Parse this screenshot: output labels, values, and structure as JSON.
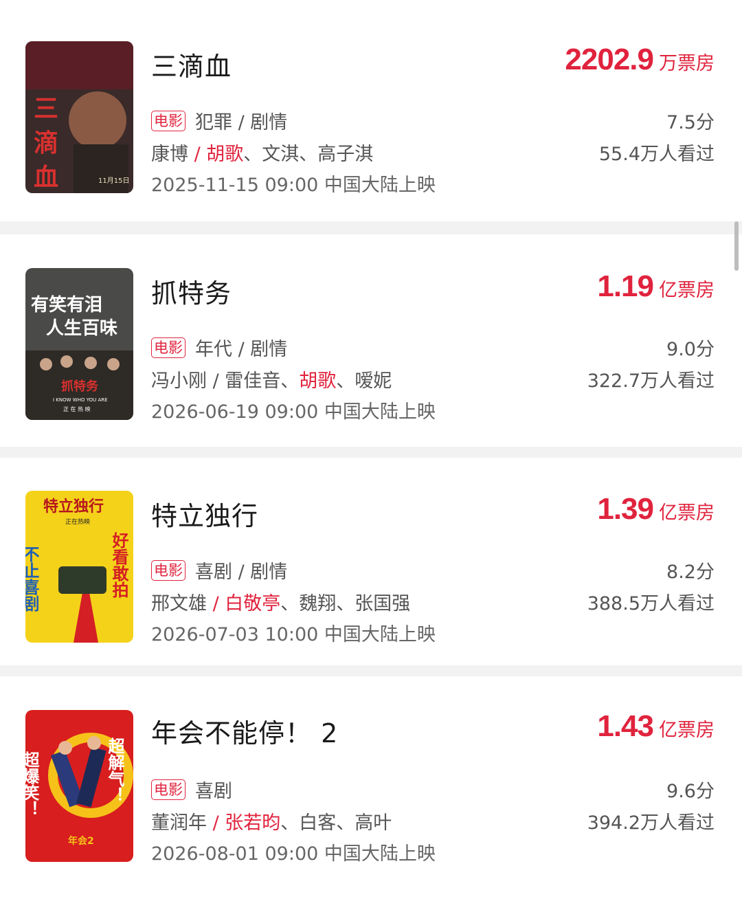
{
  "movies": [
    {
      "title": "三滴血",
      "box_number": "2202.9",
      "box_unit": "万票房",
      "badge": "电影",
      "genre": "犯罪 / 剧情",
      "director": "康博",
      "sep": " / ",
      "star": "胡歌",
      "others": "、文淇、高子淇",
      "release": "2025-11-15 09:00 中国大陆上映",
      "rating": "7.5分",
      "viewers": "55.4万人看过",
      "poster_text": [
        "三",
        "滴",
        "血",
        "11月15日"
      ]
    },
    {
      "title": "抓特务",
      "box_number": "1.19",
      "box_unit": "亿票房",
      "badge": "电影",
      "genre": "年代 / 剧情",
      "director": "冯小刚",
      "sep": " / ",
      "star": "胡歌",
      "others": "、嗳妮",
      "star_prefix": "雷佳音、",
      "release": "2026-06-19 09:00 中国大陆上映",
      "rating": "9.0分",
      "viewers": "322.7万人看过",
      "poster_text": [
        "有笑有泪",
        "人生百味",
        "抓特务",
        "I KNOW WHO YOU ARE",
        "正 在 热 映"
      ]
    },
    {
      "title": "特立独行",
      "box_number": "1.39",
      "box_unit": "亿票房",
      "badge": "电影",
      "genre": "喜剧 / 剧情",
      "director": "邢文雄",
      "sep": " / ",
      "star": "白敬亭",
      "others": "、魏翔、张国强",
      "release": "2026-07-03 10:00 中国大陆上映",
      "rating": "8.2分",
      "viewers": "388.5万人看过",
      "poster_text": [
        "特立独行",
        "正在热映",
        "不止喜剧",
        "好看敢拍"
      ]
    },
    {
      "title": "年会不能停！ 2",
      "box_number": "1.43",
      "box_unit": "亿票房",
      "badge": "电影",
      "genre": "喜剧",
      "director": "董润年",
      "sep": " / ",
      "star": "张若昀",
      "others": "、白客、高叶",
      "release": "2026-08-01 09:00 中国大陆上映",
      "rating": "9.6分",
      "viewers": "394.2万人看过",
      "poster_text": [
        "超爆笑！",
        "超解气！",
        "年会2"
      ]
    }
  ],
  "colors": {
    "accent": "#e0233d",
    "divider": "#f2f2f2"
  }
}
